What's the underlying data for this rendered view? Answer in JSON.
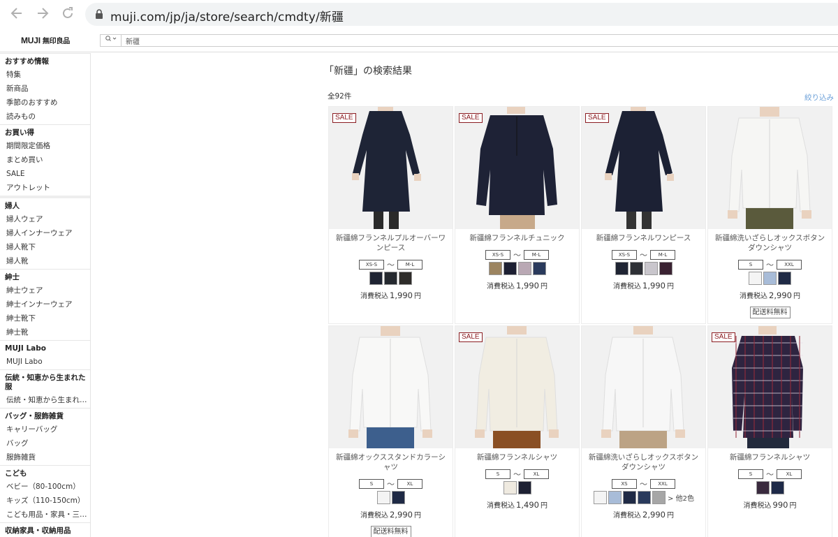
{
  "browser": {
    "url": "muji.com/jp/ja/store/search/cmdty/新疆",
    "back_icon": "back-arrow-icon",
    "forward_icon": "forward-arrow-icon",
    "reload_icon": "reload-icon"
  },
  "header": {
    "logo_en": "MUJI",
    "logo_jp": "無印良品",
    "search_value": "新疆"
  },
  "sidebar": {
    "sections": [
      {
        "heading": "おすすめ情報",
        "items": [
          "特集",
          "新商品",
          "季節のおすすめ",
          "読みもの"
        ]
      },
      {
        "heading": "お買い得",
        "items": [
          "期間限定価格",
          "まとめ買い",
          "SALE",
          "アウトレット"
        ]
      },
      {
        "heading": "婦人",
        "items": [
          "婦人ウェア",
          "婦人インナーウェア",
          "婦人靴下",
          "婦人靴"
        ]
      },
      {
        "heading": "紳士",
        "items": [
          "紳士ウェア",
          "紳士インナーウェア",
          "紳士靴下",
          "紳士靴"
        ]
      },
      {
        "heading": "MUJI Labo",
        "items": [
          "MUJI Labo"
        ]
      },
      {
        "heading": "伝統・知恵から生まれた服",
        "items": [
          "伝統・知恵から生まれた服"
        ]
      },
      {
        "heading": "バッグ・服飾雑貨",
        "items": [
          "キャリーバッグ",
          "バッグ",
          "服飾雑貨"
        ]
      },
      {
        "heading": "こども",
        "items": [
          "ベビー（80-100cm）",
          "キッズ（110-150cm）",
          "こども用品・家具・三輪車"
        ]
      },
      {
        "heading": "収納家具・収納用品",
        "items": []
      }
    ]
  },
  "results": {
    "title": "「新疆」の検索結果",
    "count": "全92件",
    "filter_label": "絞り込み",
    "sale_label": "SALE",
    "tax_label": "消費税込",
    "yen": "円",
    "shipping_label": "配送料無料",
    "colors": {
      "sale": "#8b1d22",
      "filter_link": "#6a9fd8"
    },
    "products": [
      {
        "name": "新疆綿フランネルプルオーバーワンピース",
        "sale": true,
        "size_min": "XS-S",
        "size_max": "M-L",
        "swatches": [
          "#1f2433",
          "#25292f",
          "#2e2c2a"
        ],
        "price": "1,990",
        "more": "",
        "shipping": false,
        "garment": "dress-long",
        "top": "#1e2436",
        "bottom": "#1e2436",
        "legs": "#2a2a2a"
      },
      {
        "name": "新疆綿フランネルチュニック",
        "sale": true,
        "size_min": "XS-S",
        "size_max": "M-L",
        "swatches": [
          "#9c8460",
          "#1d2033",
          "#b9a8b4",
          "#2a3a5c"
        ],
        "price": "1,990",
        "more": "",
        "shipping": false,
        "garment": "tunic",
        "top": "#1e2236",
        "bottom": "#c7a98a",
        "legs": "#e0cfc0"
      },
      {
        "name": "新疆綿フランネルワンピース",
        "sale": true,
        "size_min": "XS-S",
        "size_max": "M-L",
        "swatches": [
          "#1f2433",
          "#2e3036",
          "#c9c6cc",
          "#3a2232"
        ],
        "price": "1,990",
        "more": "",
        "shipping": false,
        "garment": "dress-long",
        "top": "#1c2134",
        "bottom": "#1c2134",
        "legs": "#333333"
      },
      {
        "name": "新疆綿洗いざらしオックスボタンダウンシャツ",
        "sale": false,
        "size_min": "S",
        "size_max": "XXL",
        "swatches": [
          "#f4f4f4",
          "#a8bcd8",
          "#1f2a45"
        ],
        "price": "2,990",
        "more": "",
        "shipping": true,
        "garment": "shirt-man",
        "top": "#f6f6f4",
        "bottom": "#5a5a3c",
        "legs": "#5a5a3c"
      },
      {
        "name": "新疆綿オックススタンドカラーシャツ",
        "sale": false,
        "size_min": "S",
        "size_max": "XL",
        "swatches": [
          "#f4f4f4",
          "#1f2a45"
        ],
        "price": "2,990",
        "more": "",
        "shipping": true,
        "garment": "shirt-man",
        "top": "#f8f8f7",
        "bottom": "#3d5f8d",
        "legs": "#3d5f8d"
      },
      {
        "name": "新疆綿フランネルシャツ",
        "sale": true,
        "size_min": "S",
        "size_max": "XL",
        "swatches": [
          "#efeae0",
          "#1d2033"
        ],
        "price": "1,490",
        "more": "",
        "shipping": false,
        "garment": "shirt-woman",
        "top": "#f1ede2",
        "bottom": "#8a4f24",
        "legs": "#8a4f24"
      },
      {
        "name": "新疆綿洗いざらしオックスボタンダウンシャツ",
        "sale": false,
        "size_min": "XS",
        "size_max": "XXL",
        "swatches": [
          "#f4f4f4",
          "#a8bcd8",
          "#1f2a45",
          "#2a3a5c",
          "#a6a6a6"
        ],
        "price": "2,990",
        "more": "> 他2色",
        "shipping": false,
        "garment": "shirt-woman",
        "top": "#f7f7f7",
        "bottom": "#bca385",
        "legs": "#bca385"
      },
      {
        "name": "新疆綿フランネルシャツ",
        "sale": true,
        "size_min": "S",
        "size_max": "XL",
        "swatches": [
          "#3a2a3e",
          "#1e2a48"
        ],
        "price": "990",
        "more": "",
        "shipping": false,
        "garment": "plaid",
        "top": "#2e2440",
        "bottom": "#222a3c",
        "legs": "#222a3c"
      }
    ]
  }
}
